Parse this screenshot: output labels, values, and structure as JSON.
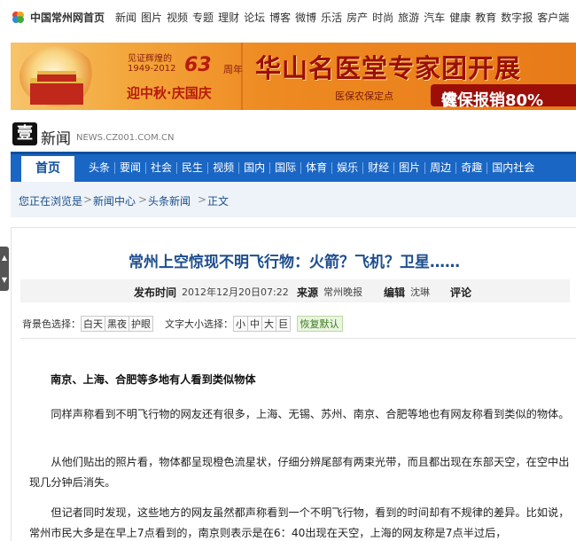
{
  "topbar": {
    "home_label": "中国常州网首页",
    "nav": [
      "新闻",
      "图片",
      "视频",
      "专题",
      "理财",
      "论坛",
      "博客",
      "微博",
      "乐活",
      "房产",
      "时尚",
      "旅游",
      "汽车",
      "健康",
      "教育",
      "数字报",
      "客户端"
    ]
  },
  "banner": {
    "line1": "见证辉煌的",
    "years": "1949-2012",
    "num": "63",
    "num_suffix": "周年",
    "festival": "迎中秋·庆国庆",
    "headline": "华山名医堂专家团开展",
    "insurance": "医保农保定点",
    "reimburse": "农保报销80%",
    "cut_char": "健"
  },
  "channel": {
    "logo": "壹",
    "title": "新闻",
    "url": "NEWS.CZ001.COM.CN"
  },
  "mainnav": {
    "home": "首页",
    "items": [
      "头条",
      "要闻",
      "社会",
      "民生",
      "视频",
      "国内",
      "国际",
      "体育",
      "娱乐",
      "财经",
      "图片",
      "周边",
      "奇趣",
      "国内社会"
    ]
  },
  "breadcrumb": {
    "label": "您正在浏览是",
    "items": [
      "新闻中心",
      "头条新闻",
      "正文"
    ]
  },
  "article": {
    "title": "常州上空惊现不明飞行物：火箭？飞机？卫星……",
    "meta": {
      "time_label": "发布时间",
      "time_value": "2012年12月20日07:22",
      "source_label": "来源",
      "source_value": "常州晚报",
      "editor_label": "编辑",
      "editor_value": "沈琳",
      "comment_label": "评论"
    },
    "options": {
      "bg_label": "背景色选择：",
      "bg_choices": [
        "白天",
        "黑夜",
        "护眼"
      ],
      "font_label": "文字大小选择：",
      "font_choices": [
        "小",
        "中",
        "大",
        "巨"
      ],
      "reset": "恢复默认"
    },
    "subheading": "南京、上海、合肥等多地有人看到类似物体",
    "paragraphs": [
      "同样声称看到不明飞行物的网友还有很多，上海、无锡、苏州、南京、合肥等地也有网友称看到类似的物体。",
      "从他们贴出的照片看，物体都呈现橙色流星状，仔细分辨尾部有两束光带，而且都出现在东部天空，在空中出现几分钟后消失。",
      "但记者同时发现，这些地方的网友虽然都声称看到一个不明飞行物，看到的时间却有不规律的差异。比如说，常州市民大多是在早上7点看到的，南京则表示是在6：40出现在天空，上海的网友称是7点半过后，"
    ]
  },
  "colors": {
    "nav_blue": "#1a66c4",
    "title_blue": "#1d4e8f"
  }
}
